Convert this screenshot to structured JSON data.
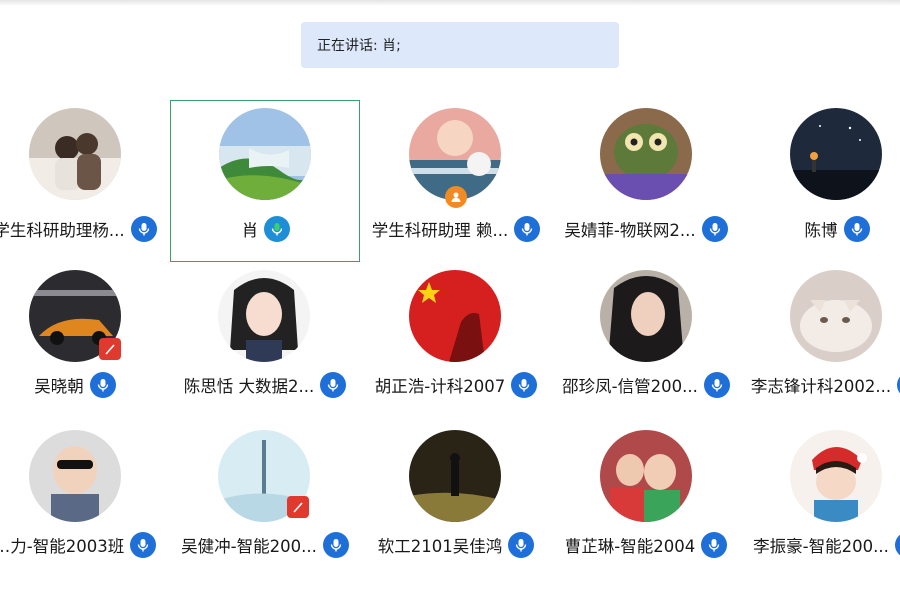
{
  "speaking": {
    "label": "正在讲话: 肖;"
  },
  "participants": [
    {
      "name": "学生科研助理杨...",
      "mic": "mic-icon"
    },
    {
      "name": "肖",
      "mic": "mic-icon",
      "active": true
    },
    {
      "name": "学生科研助理 赖...",
      "mic": "mic-icon"
    },
    {
      "name": "吴婧菲-物联网2...",
      "mic": "mic-icon"
    },
    {
      "name": "陈博",
      "mic": "mic-icon"
    },
    {
      "name": "吴晓朝",
      "mic": "mic-icon"
    },
    {
      "name": "陈思恬 大数据2...",
      "mic": "mic-icon"
    },
    {
      "name": "胡正浩-计科2007",
      "mic": "mic-icon"
    },
    {
      "name": "邵珍凤-信管200...",
      "mic": "mic-icon"
    },
    {
      "name": "李志锋计科2002...",
      "mic": "mic-icon"
    },
    {
      "name": "…力-智能2003班",
      "mic": "mic-icon"
    },
    {
      "name": "吴健冲-智能200...",
      "mic": "mic-icon"
    },
    {
      "name": "软工2101吴佳鸿",
      "mic": "mic-icon"
    },
    {
      "name": "曹芷琳-智能2004",
      "mic": "mic-icon"
    },
    {
      "name": "李振豪-智能200...",
      "mic": "mic-icon"
    }
  ],
  "colors": {
    "speaking_bg": "#dde9fb",
    "mic": "#1f6fd8",
    "active_border": "#3aa06b"
  }
}
